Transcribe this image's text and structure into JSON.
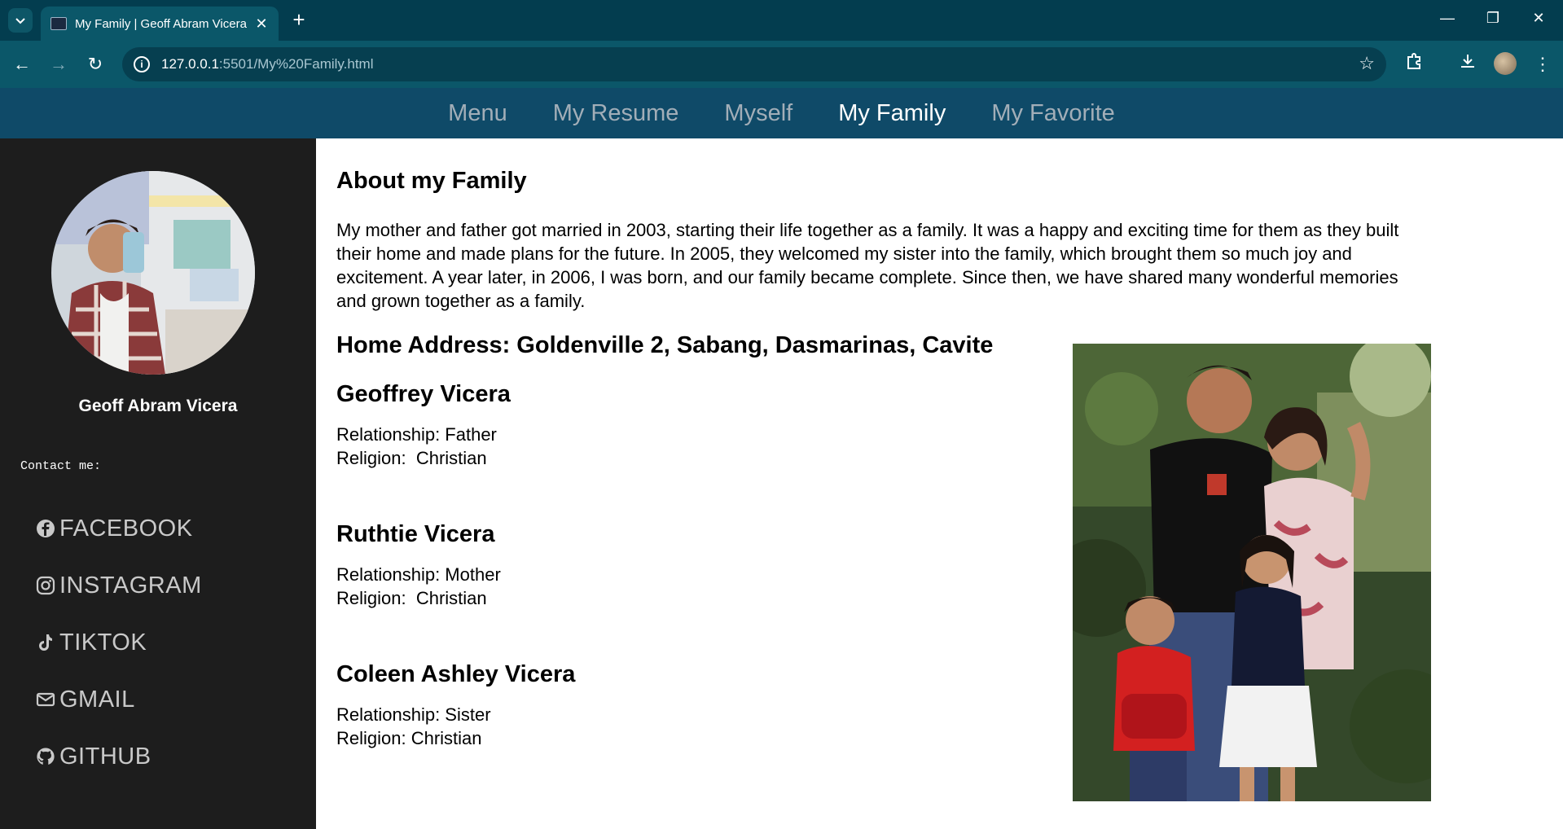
{
  "browser": {
    "tab_title": "My Family | Geoff Abram Vicera",
    "url_host": "127.0.0.1",
    "url_rest": ":5501/My%20Family.html"
  },
  "nav": {
    "items": [
      {
        "label": "Menu",
        "active": false
      },
      {
        "label": "My Resume",
        "active": false
      },
      {
        "label": "Myself",
        "active": false
      },
      {
        "label": "My Family",
        "active": true
      },
      {
        "label": "My Favorite",
        "active": false
      }
    ]
  },
  "sidebar": {
    "name": "Geoff Abram Vicera",
    "contact_label": "Contact me:",
    "links": [
      {
        "label": "FACEBOOK",
        "icon": "facebook-icon"
      },
      {
        "label": "INSTAGRAM",
        "icon": "instagram-icon"
      },
      {
        "label": "TIKTOK",
        "icon": "tiktok-icon"
      },
      {
        "label": "GMAIL",
        "icon": "mail-icon"
      },
      {
        "label": "GITHUB",
        "icon": "github-icon"
      }
    ]
  },
  "main": {
    "about_heading": "About my Family",
    "about_text": "My mother and father got married in 2003, starting their life together as a family. It was a happy and exciting time for them as they built their home and made plans for the future. In 2005, they welcomed my sister into the family, which brought them so much joy and excitement. A year later, in 2006, I was born, and our family became complete. Since then, we have shared many wonderful memories and grown together as a family.",
    "address_heading": "Home Address: Goldenville 2, Sabang, Dasmarinas, Cavite",
    "members": [
      {
        "name": "Geoffrey Vicera",
        "relationship": "Relationship: Father",
        "religion": "Religion:  Christian"
      },
      {
        "name": "Ruthtie Vicera",
        "relationship": "Relationship: Mother",
        "religion": "Religion:  Christian"
      },
      {
        "name": "Coleen Ashley Vicera",
        "relationship": "Relationship: Sister",
        "religion": "Religion: Christian"
      }
    ]
  }
}
